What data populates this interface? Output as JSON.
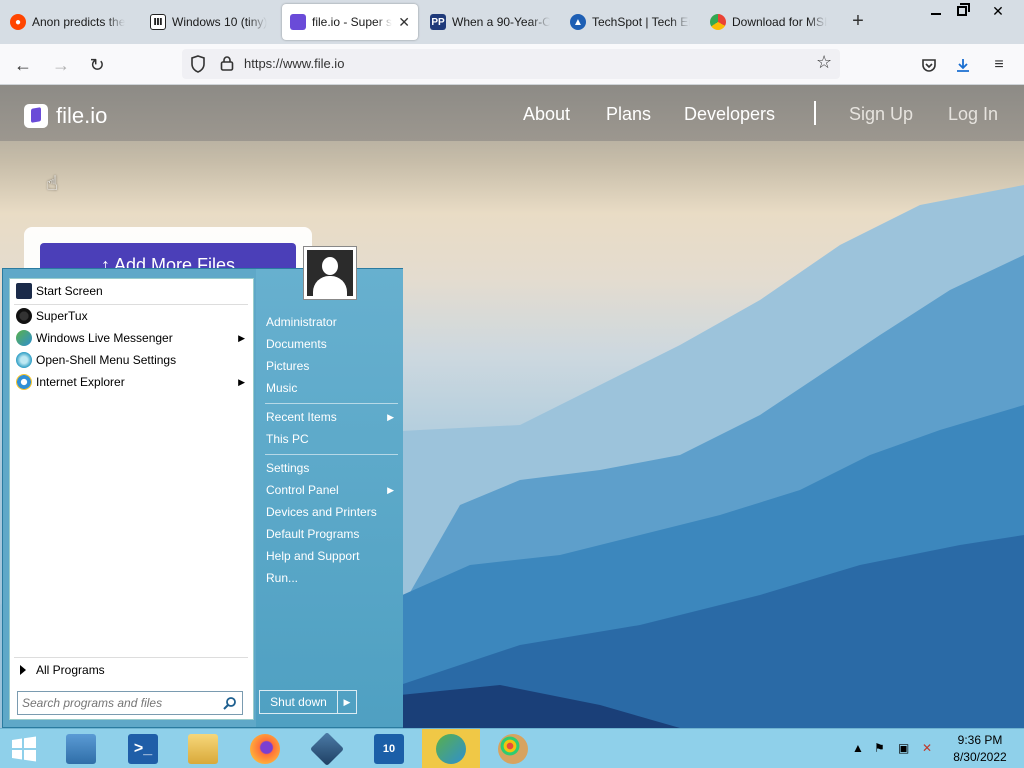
{
  "browser": {
    "tabs": [
      {
        "label": "Anon predicts the",
        "icon": "reddit-icon",
        "color": "#ff4500"
      },
      {
        "label": "Windows 10 (tiny)",
        "icon": "archive-icon",
        "color": "#222222"
      },
      {
        "label": "file.io - Super si",
        "icon": "fileio-icon",
        "color": "#6a4bd8",
        "active": true
      },
      {
        "label": "When a 90-Year-O",
        "icon": "pp-icon",
        "color": "#1f3a7a"
      },
      {
        "label": "TechSpot | Tech Er",
        "icon": "techspot-icon",
        "color": "#1e5fb4"
      },
      {
        "label": "Download for MSI",
        "icon": "chrome-icon",
        "color": "#34a853"
      }
    ],
    "url": "https://www.file.io"
  },
  "site": {
    "logo_text": "file.io",
    "nav": {
      "about": "About",
      "plans": "Plans",
      "developers": "Developers",
      "signup": "Sign Up",
      "login": "Log In"
    },
    "add_button": "↑  Add More Files"
  },
  "start_menu": {
    "left_items": [
      {
        "label": "Start Screen",
        "icon": "start-screen-icon"
      },
      {
        "label": "SuperTux",
        "icon": "supertux-icon"
      },
      {
        "label": "Windows Live Messenger",
        "icon": "messenger-icon",
        "submenu": true
      },
      {
        "label": "Open-Shell Menu Settings",
        "icon": "openshell-icon"
      },
      {
        "label": "Internet Explorer",
        "icon": "ie-icon",
        "submenu": true
      }
    ],
    "all_programs": "All Programs",
    "search_placeholder": "Search programs and files",
    "right_items": [
      {
        "label": "Administrator"
      },
      {
        "label": "Documents"
      },
      {
        "label": "Pictures"
      },
      {
        "label": "Music"
      },
      {
        "label": "Recent Items",
        "submenu": true
      },
      {
        "label": "This PC"
      },
      {
        "label": "Settings"
      },
      {
        "label": "Control Panel",
        "submenu": true
      },
      {
        "label": "Devices and Printers"
      },
      {
        "label": "Default Programs"
      },
      {
        "label": "Help and Support"
      },
      {
        "label": "Run..."
      }
    ],
    "shutdown": "Shut down"
  },
  "taskbar": {
    "time": "9:36 PM",
    "date": "8/30/2022",
    "apps": [
      {
        "name": "server-manager-icon",
        "color": "#3a7ab8"
      },
      {
        "name": "powershell-icon",
        "color": "#1f5ea8"
      },
      {
        "name": "file-explorer-icon",
        "color": "#e8c25a"
      },
      {
        "name": "firefox-icon",
        "color": "#ff7139"
      },
      {
        "name": "virtualbox-icon",
        "color": "#2f5d8a"
      },
      {
        "name": "win10-tiny-icon",
        "color": "#1b5fa8"
      },
      {
        "name": "messenger-icon",
        "color": "#4caf50",
        "active": true
      },
      {
        "name": "paint-icon",
        "color": "#c98d4b"
      }
    ]
  }
}
